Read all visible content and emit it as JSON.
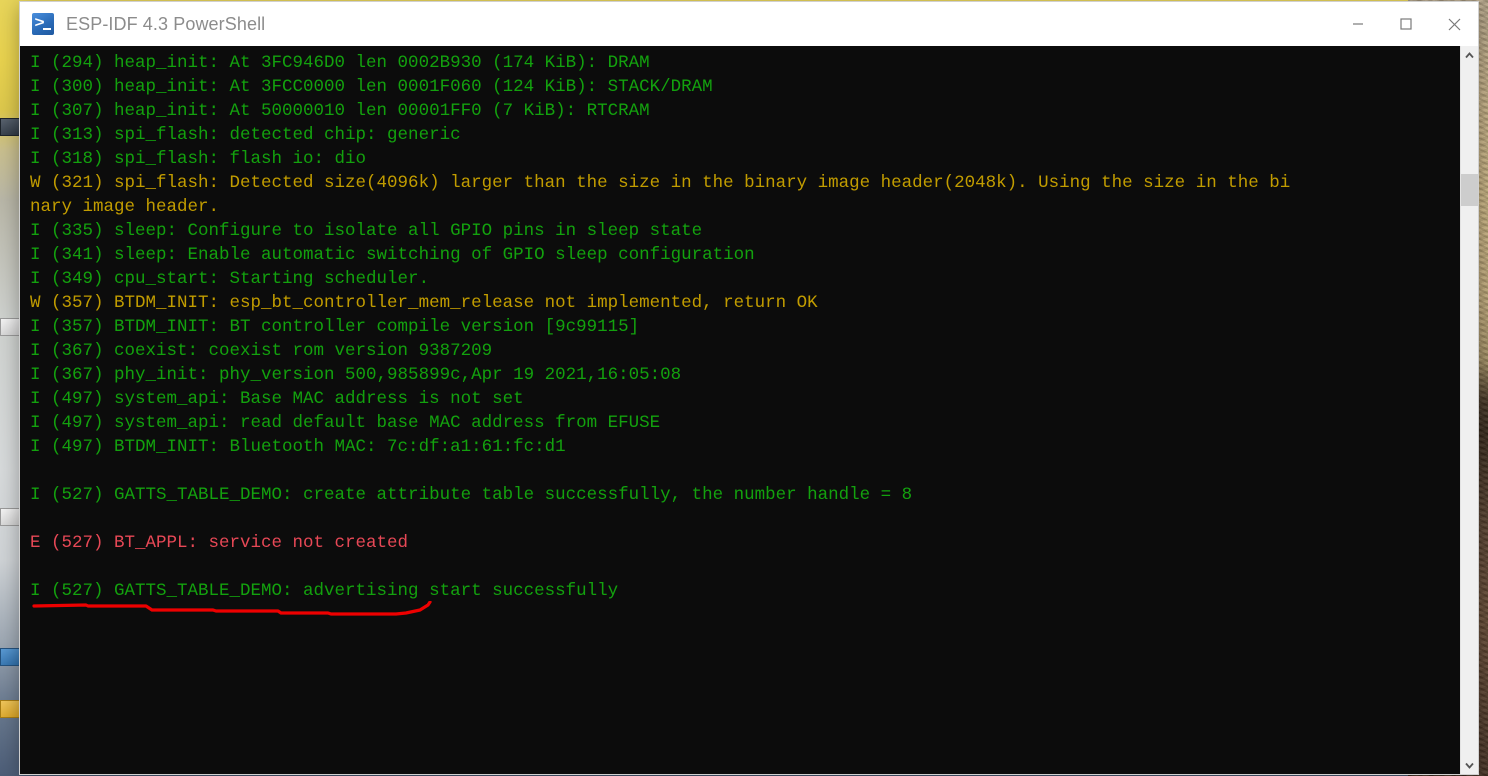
{
  "window": {
    "title": "ESP-IDF 4.3 PowerShell",
    "icon": "powershell-icon",
    "controls": {
      "minimize": "minimize-icon",
      "maximize": "maximize-icon",
      "close": "close-icon"
    }
  },
  "colors": {
    "console_background": "#0c0c0c",
    "info_green": "#13a10e",
    "warn_yellow": "#c19c00",
    "error_red": "#e74856",
    "annotation_red": "#ee0000",
    "titlebar_background": "#ffffff",
    "title_text": "#8c8c8c",
    "scrollbar_track": "#f0f0f0",
    "scrollbar_thumb": "#cdcdcd"
  },
  "console": {
    "lines": [
      {
        "level": "I",
        "text": "I (294) heap_init: At 3FC946D0 len 0002B930 (174 KiB): DRAM"
      },
      {
        "level": "I",
        "text": "I (300) heap_init: At 3FCC0000 len 0001F060 (124 KiB): STACK/DRAM"
      },
      {
        "level": "I",
        "text": "I (307) heap_init: At 50000010 len 00001FF0 (7 KiB): RTCRAM"
      },
      {
        "level": "I",
        "text": "I (313) spi_flash: detected chip: generic"
      },
      {
        "level": "I",
        "text": "I (318) spi_flash: flash io: dio"
      },
      {
        "level": "W",
        "text": "W (321) spi_flash: Detected size(4096k) larger than the size in the binary image header(2048k). Using the size in the bi"
      },
      {
        "level": "W",
        "text": "nary image header."
      },
      {
        "level": "I",
        "text": "I (335) sleep: Configure to isolate all GPIO pins in sleep state"
      },
      {
        "level": "I",
        "text": "I (341) sleep: Enable automatic switching of GPIO sleep configuration"
      },
      {
        "level": "I",
        "text": "I (349) cpu_start: Starting scheduler."
      },
      {
        "level": "W",
        "text": "W (357) BTDM_INIT: esp_bt_controller_mem_release not implemented, return OK"
      },
      {
        "level": "I",
        "text": "I (357) BTDM_INIT: BT controller compile version [9c99115]"
      },
      {
        "level": "I",
        "text": "I (367) coexist: coexist rom version 9387209"
      },
      {
        "level": "I",
        "text": "I (367) phy_init: phy_version 500,985899c,Apr 19 2021,16:05:08"
      },
      {
        "level": "I",
        "text": "I (497) system_api: Base MAC address is not set"
      },
      {
        "level": "I",
        "text": "I (497) system_api: read default base MAC address from EFUSE"
      },
      {
        "level": "I",
        "text": "I (497) BTDM_INIT: Bluetooth MAC: 7c:df:a1:61:fc:d1"
      },
      {
        "level": "I",
        "text": ""
      },
      {
        "level": "I",
        "text": "I (527) GATTS_TABLE_DEMO: create attribute table successfully, the number handle = 8"
      },
      {
        "level": "I",
        "text": ""
      },
      {
        "level": "E",
        "text": "E (527) BT_APPL: service not created"
      },
      {
        "level": "I",
        "text": ""
      },
      {
        "level": "I",
        "text": "I (527) GATTS_TABLE_DEMO: advertising start successfully"
      }
    ]
  },
  "annotation": {
    "type": "hand-drawn-underline",
    "target_line": "E (527) BT_APPL: service not created"
  },
  "scrollbar": {
    "up_arrow": "chevron-up-icon",
    "down_arrow": "chevron-down-icon",
    "thumb": "scroll-thumb"
  },
  "desktop_icons": [
    {
      "glyph": "g-blue",
      "label": ""
    },
    {
      "glyph": "g-dark",
      "label": ""
    },
    {
      "glyph": "g-doc",
      "label": ""
    },
    {
      "glyph": "g-folder",
      "label": ""
    },
    {
      "glyph": "g-doc",
      "label": ""
    }
  ]
}
